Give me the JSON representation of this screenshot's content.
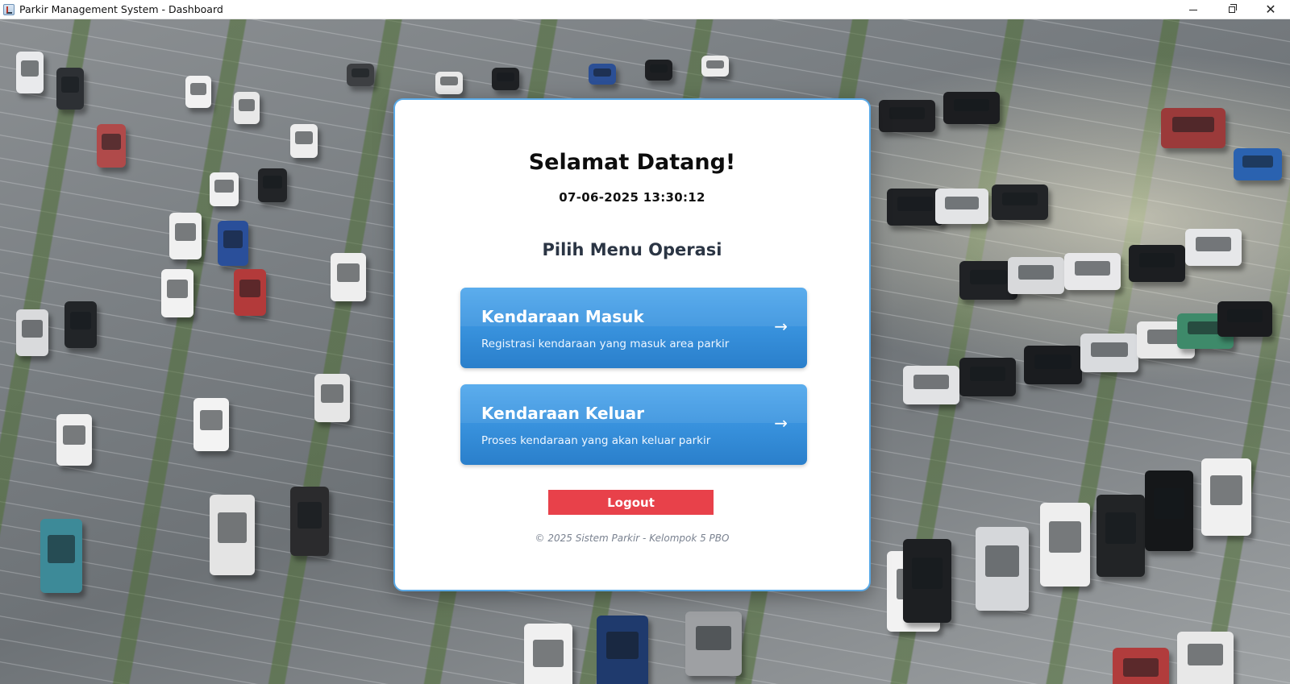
{
  "window": {
    "title": "Parkir Management System - Dashboard",
    "controls": {
      "minimize": "minimize",
      "maximize": "restore",
      "close": "close"
    }
  },
  "dashboard": {
    "welcome": "Selamat Datang!",
    "datetime": "07-06-2025 13:30:12",
    "menu_title": "Pilih Menu Operasi",
    "menu_items": [
      {
        "title": "Kendaraan Masuk",
        "subtitle": "Registrasi kendaraan yang masuk area parkir",
        "arrow": "→",
        "icon": "arrow-right-icon"
      },
      {
        "title": "Kendaraan Keluar",
        "subtitle": "Proses kendaraan yang akan keluar parkir",
        "arrow": "→",
        "icon": "arrow-right-icon"
      }
    ],
    "logout_label": "Logout",
    "footer": "© 2025 Sistem Parkir - Kelompok 5 PBO"
  },
  "colors": {
    "menu_button": "#3a94df",
    "logout_button": "#e8414a",
    "card_border": "#5aa9e6"
  }
}
